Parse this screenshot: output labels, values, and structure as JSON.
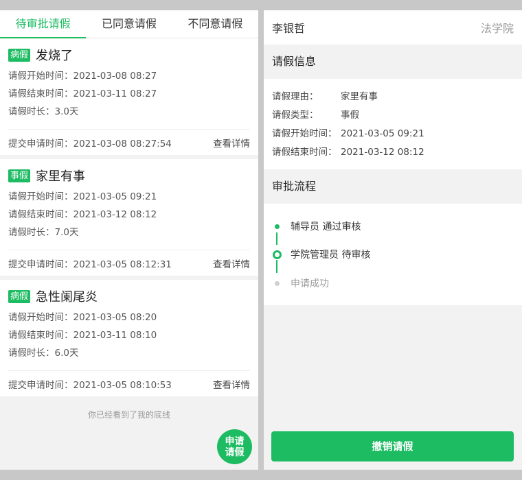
{
  "tabs": [
    {
      "label": "待审批请假",
      "active": true
    },
    {
      "label": "已同意请假",
      "active": false
    },
    {
      "label": "不同意请假",
      "active": false
    }
  ],
  "leaves": [
    {
      "type": "病假",
      "title": "发烧了",
      "start_label": "请假开始时间：",
      "start": "2021-03-08 08:27",
      "end_label": "请假结束时间：",
      "end": "2021-03-11 08:27",
      "duration_label": "请假时长：",
      "duration": "3.0天",
      "submit_label": "提交申请时间：",
      "submit": "2021-03-08 08:27:54",
      "detail": "查看详情"
    },
    {
      "type": "事假",
      "title": "家里有事",
      "start_label": "请假开始时间：",
      "start": "2021-03-05 09:21",
      "end_label": "请假结束时间：",
      "end": "2021-03-12 08:12",
      "duration_label": "请假时长：",
      "duration": "7.0天",
      "submit_label": "提交申请时间：",
      "submit": "2021-03-05 08:12:31",
      "detail": "查看详情"
    },
    {
      "type": "病假",
      "title": "急性阑尾炎",
      "start_label": "请假开始时间：",
      "start": "2021-03-05 08:20",
      "end_label": "请假结束时间：",
      "end": "2021-03-11 08:10",
      "duration_label": "请假时长：",
      "duration": "6.0天",
      "submit_label": "提交申请时间：",
      "submit": "2021-03-05 08:10:53",
      "detail": "查看详情"
    }
  ],
  "bottom_line": "你已经看到了我的底线",
  "fab_label": "申请请假",
  "detail": {
    "name": "李银哲",
    "college": "法学院",
    "info_title": "请假信息",
    "info": [
      {
        "label": "请假理由：",
        "value": "家里有事"
      },
      {
        "label": "请假类型：",
        "value": "事假"
      },
      {
        "label": "请假开始时间：",
        "value": "2021-03-05 09:21"
      },
      {
        "label": "请假结束时间：",
        "value": "2021-03-12 08:12"
      }
    ],
    "flow_title": "审批流程",
    "flow": [
      {
        "text": "辅导员 通过审核",
        "status": "done"
      },
      {
        "text": "学院管理员 待审核",
        "status": "current"
      },
      {
        "text": "申请成功",
        "status": "pending"
      }
    ],
    "cancel_label": "撤销请假"
  },
  "colors": {
    "accent": "#1dbb62",
    "background": "#f2f2f2",
    "frame": "#c8c8c8"
  }
}
